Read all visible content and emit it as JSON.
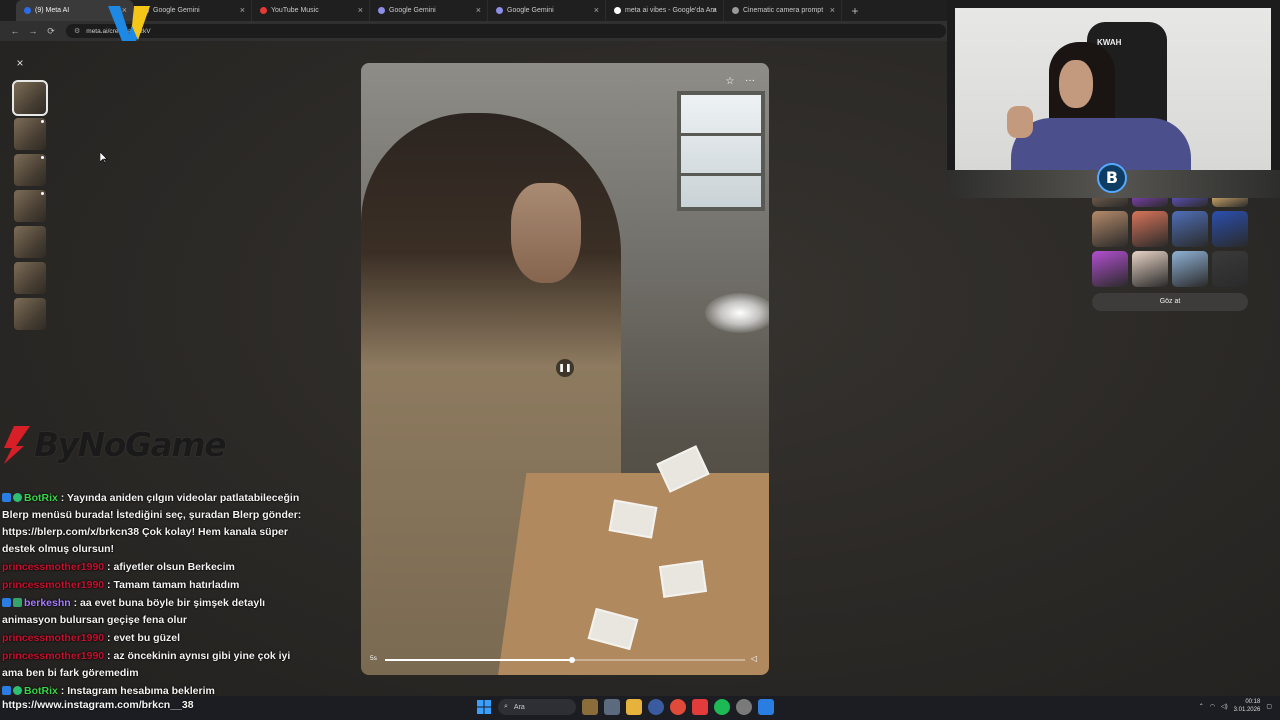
{
  "browser": {
    "tabs": [
      {
        "label": "(9) Meta AI",
        "color": "#2b6de8",
        "active": true
      },
      {
        "label": "Google Gemini",
        "color": "#8b8fe8",
        "active": false
      },
      {
        "label": "YouTube Music",
        "color": "#e53935",
        "active": false
      },
      {
        "label": "Google Gemini",
        "color": "#8b8fe8",
        "active": false
      },
      {
        "label": "Google Gemini",
        "color": "#8b8fe8",
        "active": false
      },
      {
        "label": "meta ai vibes - Google'da Ara",
        "color": "#ffffff",
        "active": false
      },
      {
        "label": "Cinematic camera prompt",
        "color": "#999999",
        "active": false
      }
    ],
    "new_tab": "+",
    "url": "meta.ai/crea...asmzkV",
    "nav": {
      "back": "←",
      "forward": "→",
      "reload": "⟳"
    }
  },
  "viewer": {
    "close": "×",
    "video_time": "5s",
    "progress_fraction": 0.52,
    "thumb_count": 7,
    "selected_thumb": 0
  },
  "sidebar_right": {
    "button_label": "Göz at",
    "grid_colors": [
      "#6d5a4a",
      "#7a3fa6",
      "#5b4fb0",
      "#c7a067",
      "#b48a6a",
      "#d9745a",
      "#4f6fb8",
      "#2b4fb0",
      "#b34fd1",
      "#e8d4c6",
      "#8fb2d6",
      "#3a3a3a"
    ]
  },
  "webcam": {
    "chair_text": "KWAH"
  },
  "logo": {
    "text": "ByNoGame"
  },
  "chat": [
    {
      "user": "BotRix",
      "cls": "uname-green",
      "badges": [
        "b1",
        "b2"
      ],
      "text": "Yayında aniden çılgın videolar patlatabileceğin Blerp menüsü burada! İstediğini seç, şuradan Blerp gönder: https://blerp.com/x/brkcn38 Çok kolay! Hem kanala süper destek olmuş olursun!"
    },
    {
      "user": "princessmother1990",
      "cls": "uname-red",
      "badges": [],
      "text": "afiyetler olsun Berkecim"
    },
    {
      "user": "princessmother1990",
      "cls": "uname-red",
      "badges": [],
      "text": "Tamam tamam hatırladım"
    },
    {
      "user": "berkeshn",
      "cls": "uname-purple",
      "badges": [
        "b1",
        "b3"
      ],
      "text": "aa evet buna böyle bir şimşek detaylı animasyon bulursan geçişe fena olur"
    },
    {
      "user": "princessmother1990",
      "cls": "uname-red",
      "badges": [],
      "text": "evet bu güzel"
    },
    {
      "user": "princessmother1990",
      "cls": "uname-red",
      "badges": [],
      "text": "az öncekinin aynısı gibi yine çok iyi ama ben bi fark göremedim"
    },
    {
      "user": "BotRix",
      "cls": "uname-green",
      "badges": [
        "b1",
        "b2"
      ],
      "text": "Instagram hesabıma beklerim"
    }
  ],
  "taskbar": {
    "chat_url_line": "https://www.instagram.com/brkcn__38",
    "search_label": "Ara",
    "time": "00:18",
    "date": "3.01.2026"
  }
}
